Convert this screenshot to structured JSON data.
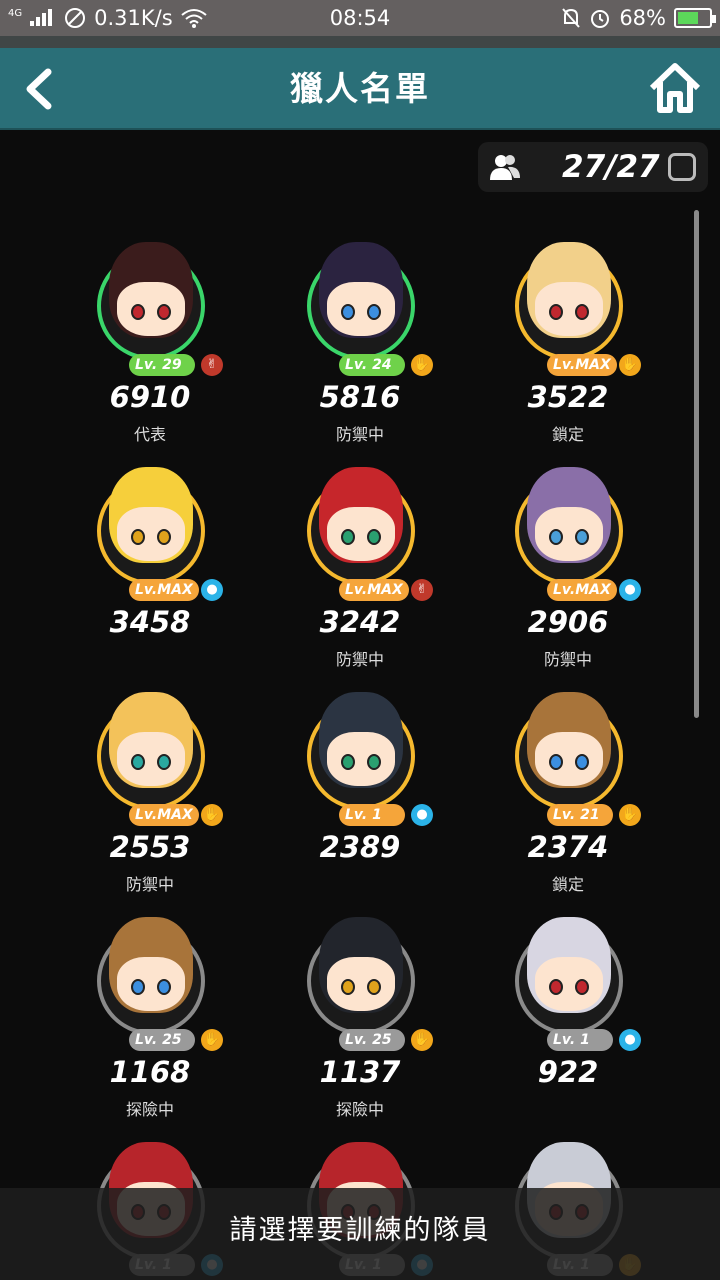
{
  "status_bar": {
    "network": "4G",
    "speed": "0.31K/s",
    "time": "08:54",
    "battery": "68%"
  },
  "header": {
    "title": "獵人名單"
  },
  "counter": {
    "value": "27/27"
  },
  "hunters": [
    {
      "level": "Lv. 29",
      "power": "6910",
      "status": "代表",
      "ring": "#3ad66a",
      "hair": "#3b1c1c",
      "element": "rock",
      "elemColor": "#c0392b",
      "lvColor": "#6fd24a",
      "eyes": "#c0282f"
    },
    {
      "level": "Lv. 24",
      "power": "5816",
      "status": "防禦中",
      "ring": "#3ad66a",
      "hair": "#2b2340",
      "element": "paper",
      "elemColor": "#f2a71b",
      "lvColor": "#6fd24a",
      "eyes": "#3c8fe0"
    },
    {
      "level": "Lv.MAX",
      "power": "3522",
      "status": "鎖定",
      "ring": "#f5b92e",
      "hair": "#f2d08a",
      "element": "paper",
      "elemColor": "#f2a71b",
      "lvColor": "#f5a53a",
      "eyes": "#c0282f"
    },
    {
      "level": "Lv.MAX",
      "power": "3458",
      "status": "",
      "ring": "#f5b92e",
      "hair": "#f6cf3b",
      "element": "water",
      "elemColor": "#2bb3e8",
      "lvColor": "#f5a53a",
      "eyes": "#e0a31c"
    },
    {
      "level": "Lv.MAX",
      "power": "3242",
      "status": "防禦中",
      "ring": "#f5b92e",
      "hair": "#c6262b",
      "element": "rock",
      "elemColor": "#c0392b",
      "lvColor": "#f5a53a",
      "eyes": "#2aa070"
    },
    {
      "level": "Lv.MAX",
      "power": "2906",
      "status": "防禦中",
      "ring": "#f5b92e",
      "hair": "#8a6fa8",
      "element": "water",
      "elemColor": "#2bb3e8",
      "lvColor": "#f5a53a",
      "eyes": "#4a9fd8"
    },
    {
      "level": "Lv.MAX",
      "power": "2553",
      "status": "防禦中",
      "ring": "#f5b92e",
      "hair": "#f3c25a",
      "element": "paper",
      "elemColor": "#f2a71b",
      "lvColor": "#f5a53a",
      "eyes": "#2aa8a0"
    },
    {
      "level": "Lv. 1",
      "power": "2389",
      "status": "",
      "ring": "#f5b92e",
      "hair": "#2b3442",
      "element": "water",
      "elemColor": "#2bb3e8",
      "lvColor": "#f5a53a",
      "eyes": "#2aa070"
    },
    {
      "level": "Lv. 21",
      "power": "2374",
      "status": "鎖定",
      "ring": "#f5b92e",
      "hair": "#a8743a",
      "element": "paper",
      "elemColor": "#f2a71b",
      "lvColor": "#f5a53a",
      "eyes": "#3c8fe0"
    },
    {
      "level": "Lv. 25",
      "power": "1168",
      "status": "探險中",
      "ring": "#8a8a8a",
      "hair": "#a8743a",
      "element": "paper",
      "elemColor": "#f2a71b",
      "lvColor": "#9a9a9a",
      "eyes": "#3c8fe0"
    },
    {
      "level": "Lv. 25",
      "power": "1137",
      "status": "探險中",
      "ring": "#8a8a8a",
      "hair": "#22252c",
      "element": "paper",
      "elemColor": "#f2a71b",
      "lvColor": "#9a9a9a",
      "eyes": "#e0a31c"
    },
    {
      "level": "Lv. 1",
      "power": "922",
      "status": "",
      "ring": "#8a8a8a",
      "hair": "#d8d6e2",
      "element": "water",
      "elemColor": "#2bb3e8",
      "lvColor": "#9a9a9a",
      "eyes": "#c0282f"
    },
    {
      "level": "Lv. 1",
      "power": "",
      "status": "",
      "ring": "#8a8a8a",
      "hair": "#b7252b",
      "element": "water",
      "elemColor": "#2bb3e8",
      "lvColor": "#9a9a9a",
      "eyes": "#c0282f"
    },
    {
      "level": "Lv. 1",
      "power": "",
      "status": "",
      "ring": "#8a8a8a",
      "hair": "#b7252b",
      "element": "water",
      "elemColor": "#2bb3e8",
      "lvColor": "#9a9a9a",
      "eyes": "#c0282f"
    },
    {
      "level": "Lv. 1",
      "power": "",
      "status": "",
      "ring": "#8a8a8a",
      "hair": "#c9ccd6",
      "element": "paper",
      "elemColor": "#f2a71b",
      "lvColor": "#9a9a9a",
      "eyes": "#c0282f"
    }
  ],
  "toast": "請選擇要訓練的隊員",
  "colors": {
    "header_bg": "#2a6f78",
    "page_bg": "#0c0c0c"
  }
}
